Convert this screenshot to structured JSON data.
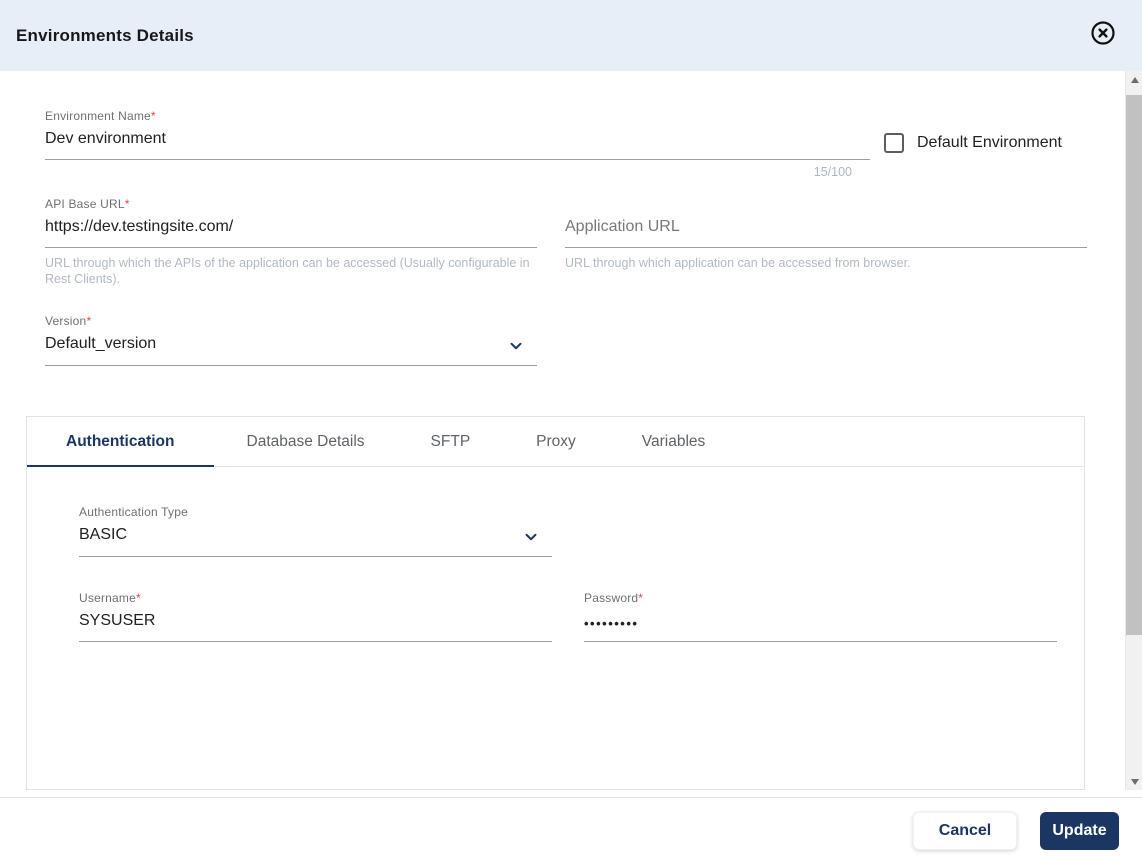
{
  "ui": {
    "required_marker": "*"
  },
  "header": {
    "title": "Environments Details"
  },
  "icons": {
    "close": "circle-x-icon",
    "dropdown": "chevron-down-icon",
    "scroll_up": "triangle-up-icon",
    "scroll_down": "triangle-down-icon"
  },
  "form": {
    "environment_name": {
      "label": "Environment Name",
      "required": true,
      "value": "Dev environment",
      "counter": "15/100"
    },
    "default_environment": {
      "label": "Default Environment",
      "checked": false
    },
    "api_base_url": {
      "label": "API Base URL",
      "required": true,
      "value": "https://dev.testingsite.com/",
      "helper": "URL through which the APIs of the application can be accessed (Usually configurable in Rest Clients)."
    },
    "application_url": {
      "placeholder": "Application URL",
      "value": "",
      "helper": "URL through which application can be accessed from browser."
    },
    "version": {
      "label": "Version",
      "required": true,
      "value": "Default_version"
    }
  },
  "tabs": [
    {
      "label": "Authentication",
      "active": true
    },
    {
      "label": "Database Details",
      "active": false
    },
    {
      "label": "SFTP",
      "active": false
    },
    {
      "label": "Proxy",
      "active": false
    },
    {
      "label": "Variables",
      "active": false
    }
  ],
  "auth": {
    "authentication_type": {
      "label": "Authentication Type",
      "value": "BASIC"
    },
    "username": {
      "label": "Username",
      "required": true,
      "value": "SYSUSER"
    },
    "password": {
      "label": "Password",
      "required": true,
      "masked_value": "•••••••••"
    }
  },
  "footer": {
    "cancel_label": "Cancel",
    "update_label": "Update"
  },
  "colors": {
    "header_bg": "#e8eef7",
    "accent_navy": "#1c3664",
    "required_red": "#e8423c",
    "label_gray": "#6c7075",
    "helper_gray": "#b2b9c3",
    "underline_gray": "#9e9e9e",
    "input_text": "#202124"
  }
}
